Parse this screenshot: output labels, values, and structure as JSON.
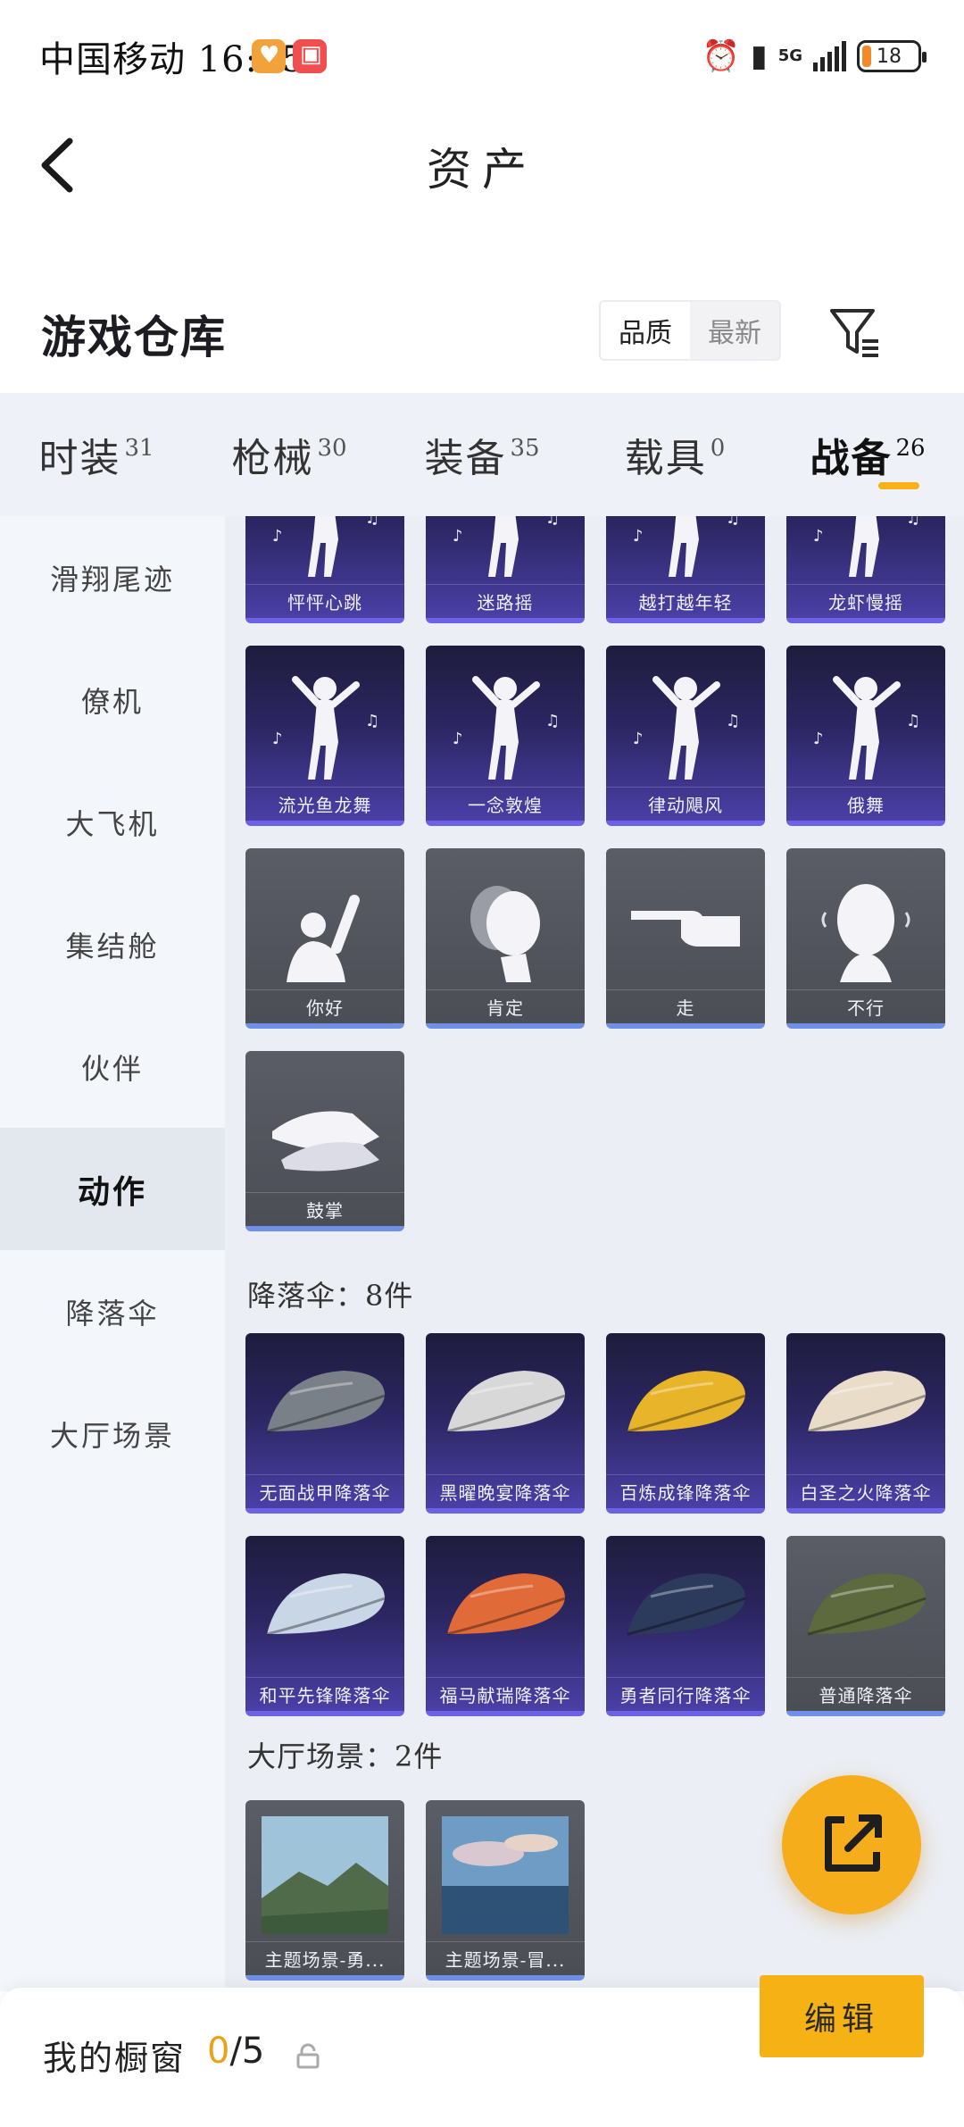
{
  "status_bar": {
    "carrier_time": "中国移动 16:05",
    "network": "5G",
    "battery": "18"
  },
  "header": {
    "title": "资产"
  },
  "warehouse": {
    "title": "游戏仓库",
    "sort_options": [
      "品质",
      "最新"
    ],
    "active_sort": "品质"
  },
  "category_tabs": [
    {
      "label": "时装",
      "count": "31"
    },
    {
      "label": "枪械",
      "count": "30"
    },
    {
      "label": "装备",
      "count": "35"
    },
    {
      "label": "载具",
      "count": "0"
    },
    {
      "label": "战备",
      "count": "26"
    }
  ],
  "active_category": "战备",
  "side_nav": [
    {
      "label": "滑翔尾迹"
    },
    {
      "label": "僚机"
    },
    {
      "label": "大飞机"
    },
    {
      "label": "集结舱"
    },
    {
      "label": "伙伴"
    },
    {
      "label": "动作"
    },
    {
      "label": "降落伞"
    },
    {
      "label": "大厅场景"
    }
  ],
  "active_side": "动作",
  "actions": [
    {
      "name": "怦怦心跳",
      "rarity": "purple",
      "art": "dance"
    },
    {
      "name": "迷路摇",
      "rarity": "purple",
      "art": "dance"
    },
    {
      "name": "越打越年轻",
      "rarity": "purple",
      "art": "dance"
    },
    {
      "name": "龙虾慢摇",
      "rarity": "purple",
      "art": "dance"
    },
    {
      "name": "流光鱼龙舞",
      "rarity": "purple",
      "art": "dance"
    },
    {
      "name": "一念敦煌",
      "rarity": "purple",
      "art": "dance"
    },
    {
      "name": "律动飓风",
      "rarity": "purple",
      "art": "dance"
    },
    {
      "name": "俄舞",
      "rarity": "purple",
      "art": "dance"
    },
    {
      "name": "你好",
      "rarity": "gray",
      "art": "wave"
    },
    {
      "name": "肯定",
      "rarity": "gray",
      "art": "nod"
    },
    {
      "name": "走",
      "rarity": "gray",
      "art": "point"
    },
    {
      "name": "不行",
      "rarity": "gray",
      "art": "shake"
    },
    {
      "name": "鼓掌",
      "rarity": "gray",
      "art": "clap"
    }
  ],
  "parachute_header": "降落伞：8件",
  "parachutes": [
    {
      "name": "无面战甲降落伞",
      "rarity": "purple",
      "color": "#7a8088"
    },
    {
      "name": "黑曜晚宴降落伞",
      "rarity": "purple",
      "color": "#d8d8d8"
    },
    {
      "name": "百炼成锋降落伞",
      "rarity": "purple",
      "color": "#e8b42a"
    },
    {
      "name": "白圣之火降落伞",
      "rarity": "purple",
      "color": "#e9dcc8"
    },
    {
      "name": "和平先锋降落伞",
      "rarity": "purple",
      "color": "#c9d6e6"
    },
    {
      "name": "福马献瑞降落伞",
      "rarity": "purple",
      "color": "#e06a38"
    },
    {
      "name": "勇者同行降落伞",
      "rarity": "purple",
      "color": "#2c3a5c"
    },
    {
      "name": "普通降落伞",
      "rarity": "gray",
      "color": "#5d6a3e"
    }
  ],
  "lobby_header": "大厅场景：2件",
  "lobby_scenes": [
    {
      "name": "主题场景-勇...",
      "rarity": "gray"
    },
    {
      "name": "主题场景-冒...",
      "rarity": "gray"
    }
  ],
  "bottom_bar": {
    "label": "我的橱窗",
    "current": "0",
    "total": "/5",
    "edit": "编辑"
  },
  "colors": {
    "accent": "#f6b114",
    "purple_card": "#4a3fa6",
    "gray_card": "#4c4e56"
  }
}
